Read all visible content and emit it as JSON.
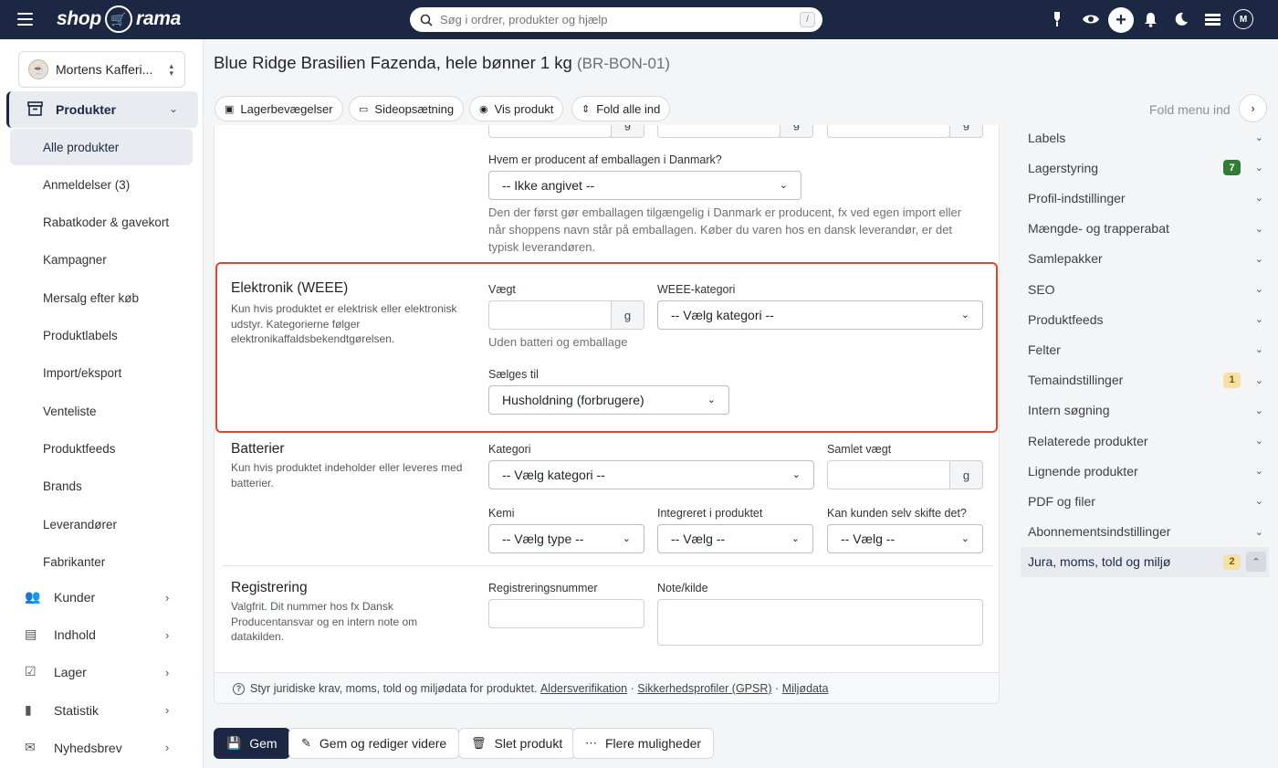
{
  "topbar": {
    "logo_left": "shop",
    "logo_right": "rama",
    "search_placeholder": "Søg i ordrer, produkter og hjælp",
    "search_shortcut": "/",
    "avatar_initial": "M"
  },
  "sidebar": {
    "shop_name": "Mortens Kafferi...",
    "section": "Produkter",
    "sub_items": [
      "Alle produkter",
      "Anmeldelser (3)",
      "Rabatkoder & gavekort",
      "Kampagner",
      "Mersalg efter køb",
      "Produktlabels",
      "Import/eksport",
      "Venteliste",
      "Produktfeeds",
      "Brands",
      "Leverandører",
      "Fabrikanter"
    ],
    "main_items": [
      "Kunder",
      "Indhold",
      "Lager",
      "Statistik",
      "Nyhedsbrev"
    ]
  },
  "page": {
    "title": "Blue Ridge Brasilien Fazenda, hele bønner 1 kg",
    "sku": "(BR-BON-01)",
    "toolbar": [
      "Lagerbevægelser",
      "Sideopsætning",
      "Vis produkt",
      "Fold alle ind"
    ],
    "fold_menu_label": "Fold menu ind"
  },
  "packaging": {
    "unit_g": "g",
    "producer_label": "Hvem er producent af emballagen i Danmark?",
    "producer_value": "-- Ikke angivet --",
    "producer_help": "Den der først gør emballagen tilgængelig i Danmark er producent, fx ved egen import eller når shoppens navn står på emballagen. Køber du varen hos en dansk leverandør, er det typisk leverandøren."
  },
  "weee": {
    "title": "Elektronik (WEEE)",
    "desc": "Kun hvis produktet er elektrisk eller elektronisk udstyr. Kategorierne følger elektronikaffaldsbekendtgørelsen.",
    "weight_label": "Vægt",
    "weight_value": "",
    "unit": "g",
    "weight_help": "Uden batteri og emballage",
    "category_label": "WEEE-kategori",
    "category_value": "-- Vælg kategori --",
    "sold_to_label": "Sælges til",
    "sold_to_value": "Husholdning (forbrugere)"
  },
  "batteries": {
    "title": "Batterier",
    "desc": "Kun hvis produktet indeholder eller leveres med batterier.",
    "category_label": "Kategori",
    "category_value": "-- Vælg kategori --",
    "total_weight_label": "Samlet vægt",
    "total_weight_value": "",
    "unit": "g",
    "chem_label": "Kemi",
    "chem_value": "-- Vælg type --",
    "integrated_label": "Integreret i produktet",
    "integrated_value": "-- Vælg --",
    "replace_label": "Kan kunden selv skifte det?",
    "replace_value": "-- Vælg --"
  },
  "registration": {
    "title": "Registrering",
    "desc": "Valgfrit. Dit nummer hos fx Dansk Producentansvar og en intern note om datakilden.",
    "reg_label": "Registreringsnummer",
    "reg_value": "",
    "note_label": "Note/kilde",
    "note_value": ""
  },
  "footer": {
    "text": "Styr juridiske krav, moms, told og miljødata for produktet.",
    "links": [
      "Aldersverifikation",
      "Sikkerhedsprofiler (GPSR)",
      "Miljødata"
    ],
    "sep": "·"
  },
  "right_menu": [
    {
      "label": "Labels",
      "badge": ""
    },
    {
      "label": "Lagerstyring",
      "badge": "7",
      "badge_color": "#2e7d32"
    },
    {
      "label": "Profil-indstillinger",
      "badge": ""
    },
    {
      "label": "Mængde- og trapperabat",
      "badge": ""
    },
    {
      "label": "Samlepakker",
      "badge": ""
    },
    {
      "label": "SEO",
      "badge": ""
    },
    {
      "label": "Produktfeeds",
      "badge": ""
    },
    {
      "label": "Felter",
      "badge": ""
    },
    {
      "label": "Temaindstillinger",
      "badge": "1",
      "badge_color": "#f7e0a8"
    },
    {
      "label": "Intern søgning",
      "badge": ""
    },
    {
      "label": "Relaterede produkter",
      "badge": ""
    },
    {
      "label": "Lignende produkter",
      "badge": ""
    },
    {
      "label": "PDF og filer",
      "badge": ""
    },
    {
      "label": "Abonnementsindstillinger",
      "badge": ""
    },
    {
      "label": "Jura, moms, told og miljø",
      "badge": "2",
      "badge_color": "#f7e0a8"
    }
  ],
  "actions": [
    "Gem",
    "Gem og rediger videre",
    "Slet produkt",
    "Flere muligheder"
  ],
  "colors": {
    "brand": "#1c2744",
    "highlight": "#e0452b"
  }
}
